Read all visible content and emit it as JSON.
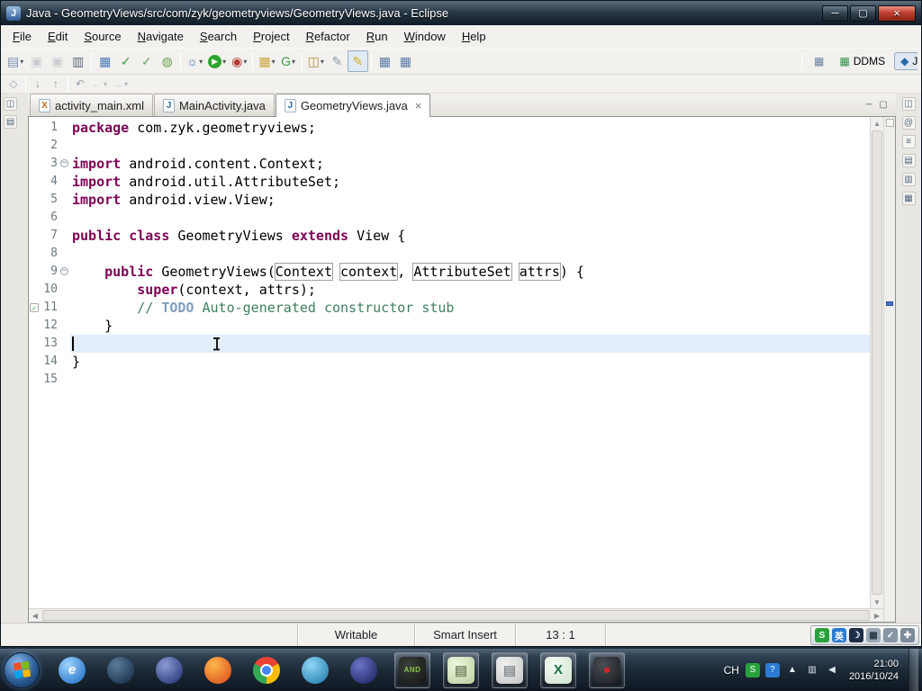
{
  "window": {
    "title": "Java - GeometryViews/src/com/zyk/geometryviews/GeometryViews.java - Eclipse",
    "app_icon_glyph": "J",
    "controls": {
      "minimize": "─",
      "maximize": "▢",
      "close": "×"
    }
  },
  "icons": {
    "dropdown": "▾",
    "tab_close": "×",
    "fold_collapsed": "−",
    "task_check": "✓",
    "scroll_up": "▲",
    "scroll_down": "▼",
    "scroll_left": "◀",
    "scroll_right": "▶",
    "minimize_view": "─",
    "maximize_view": "▢"
  },
  "menubar": {
    "items": [
      "File",
      "Edit",
      "Source",
      "Navigate",
      "Search",
      "Project",
      "Refactor",
      "Run",
      "Window",
      "Help"
    ]
  },
  "toolbar": {
    "buttons": [
      {
        "name": "new-wizard-button",
        "glyph": "▤",
        "color": "#7a8fb3",
        "dropdown": true
      },
      {
        "name": "save-button",
        "glyph": "▣",
        "color": "#8b98a8",
        "disabled": true
      },
      {
        "name": "save-all-button",
        "glyph": "▣",
        "color": "#8b98a8",
        "disabled": true
      },
      {
        "name": "print-button",
        "glyph": "▥",
        "color": "#5d6d80"
      },
      {
        "sep": true
      },
      {
        "name": "sdk-manager-button",
        "glyph": "▦",
        "color": "#4a79b8"
      },
      {
        "name": "task-list-button",
        "glyph": "✓",
        "color": "#3f9b47"
      },
      {
        "name": "verify-button",
        "glyph": "✓",
        "color": "#6aa86e"
      },
      {
        "name": "avd-manager-button",
        "glyph": "◍",
        "color": "#67a24c"
      },
      {
        "sep": true
      },
      {
        "name": "debug-button",
        "glyph": "☼",
        "color": "#3f6fb5",
        "dropdown": true
      },
      {
        "name": "run-button",
        "glyph": "▶",
        "color": "#ffffff",
        "bg": "#2ea52e",
        "dropdown": true
      },
      {
        "name": "external-tools-button",
        "glyph": "◉",
        "color": "#b23b2e",
        "dropdown": true
      },
      {
        "sep": true
      },
      {
        "name": "open-ddms-grid-button",
        "glyph": "▦",
        "color": "#caa53d",
        "dropdown": true
      },
      {
        "name": "sync-button",
        "glyph": "G",
        "color": "#3f9b47",
        "dropdown": true
      },
      {
        "sep": true
      },
      {
        "name": "new-java-element-button",
        "glyph": "◫",
        "color": "#b98a3f",
        "dropdown": true
      },
      {
        "name": "search-button",
        "glyph": "✎",
        "color": "#8d99a6"
      },
      {
        "name": "mark-occurrences-button",
        "glyph": "✎",
        "color": "#d6b01f",
        "pressed": true
      },
      {
        "sep": true
      },
      {
        "name": "annotations-button",
        "glyph": "▦",
        "color": "#5a7ca8"
      },
      {
        "name": "table-view-button",
        "glyph": "▦",
        "color": "#5a7ca8"
      }
    ],
    "perspectives": {
      "open_glyph": "▦",
      "ddms_glyph": "▦",
      "java_glyph": "◆",
      "ddms": "DDMS",
      "java": "Ja"
    }
  },
  "toolbar2": {
    "buttons": [
      {
        "name": "pin-editor-button",
        "glyph": "◇",
        "color": "#97a2ad"
      },
      {
        "sep": true
      },
      {
        "name": "next-annotation-button",
        "glyph": "↓",
        "color": "#8f9aa5"
      },
      {
        "name": "prev-annotation-button",
        "glyph": "↑",
        "color": "#8f9aa5"
      },
      {
        "sep": true
      },
      {
        "name": "last-edit-location-button",
        "glyph": "↶",
        "color": "#97a2ad"
      },
      {
        "name": "back-button",
        "glyph": "←",
        "color": "#9aa5b0",
        "dropdown": true,
        "disabled": true
      },
      {
        "name": "forward-button",
        "glyph": "→",
        "color": "#9aa5b0",
        "dropdown": true,
        "disabled": true
      }
    ]
  },
  "left_strip": {
    "icons": [
      {
        "name": "restore-package-explorer-icon",
        "glyph": "◫"
      },
      {
        "name": "restore-hierarchy-icon",
        "glyph": "▤"
      }
    ]
  },
  "right_strip": {
    "icons": [
      {
        "name": "restore-view-icon",
        "glyph": "◫"
      },
      {
        "name": "javadoc-view-icon",
        "glyph": "@"
      },
      {
        "name": "declaration-view-icon",
        "glyph": "≡"
      },
      {
        "name": "outline-view-icon",
        "glyph": "▤"
      },
      {
        "name": "problems-view-icon",
        "glyph": "▥"
      },
      {
        "name": "console-view-icon",
        "glyph": "▦"
      }
    ]
  },
  "tabs": [
    {
      "label": "activity_main.xml",
      "icon": "X",
      "icon_color": "#c06820",
      "active": false
    },
    {
      "label": "MainActivity.java",
      "icon": "J",
      "icon_color": "#2a66a8",
      "active": false
    },
    {
      "label": "GeometryViews.java",
      "icon": "J",
      "icon_color": "#2a66a8",
      "active": true
    }
  ],
  "editor": {
    "lines": [
      {
        "num": "1",
        "tokens": [
          [
            "kw",
            "package"
          ],
          [
            "pl",
            " com.zyk.geometryviews;"
          ]
        ]
      },
      {
        "num": "2",
        "tokens": []
      },
      {
        "num": "3",
        "fold": true,
        "tokens": [
          [
            "kw",
            "import"
          ],
          [
            "pl",
            " android.content.Context;"
          ]
        ]
      },
      {
        "num": "4",
        "tokens": [
          [
            "kw",
            "import"
          ],
          [
            "pl",
            " android.util.AttributeSet;"
          ]
        ]
      },
      {
        "num": "5",
        "tokens": [
          [
            "kw",
            "import"
          ],
          [
            "pl",
            " android.view.View;"
          ]
        ]
      },
      {
        "num": "6",
        "tokens": []
      },
      {
        "num": "7",
        "tokens": [
          [
            "kw",
            "public"
          ],
          [
            "pl",
            " "
          ],
          [
            "kw",
            "class"
          ],
          [
            "pl",
            " GeometryViews "
          ],
          [
            "kw",
            "extends"
          ],
          [
            "pl",
            " View {"
          ]
        ]
      },
      {
        "num": "8",
        "tokens": []
      },
      {
        "num": "9",
        "fold": true,
        "tokens": [
          [
            "pl",
            "    "
          ],
          [
            "kw",
            "public"
          ],
          [
            "pl",
            " GeometryViews("
          ],
          [
            "box",
            "Context"
          ],
          [
            "pl",
            " "
          ],
          [
            "box",
            "context"
          ],
          [
            "pl",
            ", "
          ],
          [
            "box",
            "AttributeSet"
          ],
          [
            "pl",
            " "
          ],
          [
            "box",
            "attrs"
          ],
          [
            "pl",
            ") {"
          ]
        ]
      },
      {
        "num": "10",
        "tokens": [
          [
            "pl",
            "        "
          ],
          [
            "kw",
            "super"
          ],
          [
            "pl",
            "(context, attrs);"
          ]
        ]
      },
      {
        "num": "11",
        "task": true,
        "tokens": [
          [
            "pl",
            "        "
          ],
          [
            "cm",
            "// "
          ],
          [
            "todo",
            "TODO"
          ],
          [
            "cm",
            " Auto-generated constructor stub"
          ]
        ]
      },
      {
        "num": "12",
        "tokens": [
          [
            "pl",
            "    }"
          ]
        ]
      },
      {
        "num": "13",
        "current": true,
        "caret": true,
        "tokens": []
      },
      {
        "num": "14",
        "tokens": [
          [
            "pl",
            "}"
          ]
        ]
      },
      {
        "num": "15",
        "tokens": []
      }
    ]
  },
  "statusbar": {
    "writable": "Writable",
    "insert_mode": "Smart Insert",
    "caret_position": "13 : 1"
  },
  "ime_bar": {
    "icons": [
      {
        "name": "ime-logo-icon",
        "glyph": "S",
        "bg": "#27a23c",
        "fg": "#ffffff"
      },
      {
        "name": "ime-lang-icon",
        "glyph": "英",
        "bg": "#2b7bd4",
        "fg": "#ffffff"
      },
      {
        "name": "ime-halfwidth-icon",
        "glyph": "☽",
        "bg": "#1d2c47",
        "fg": "#e8f0fa"
      },
      {
        "name": "ime-keyboard-icon",
        "glyph": "▦",
        "bg": "#9aa7b5",
        "fg": "#2c3947"
      },
      {
        "name": "ime-symbols-icon",
        "glyph": "✓",
        "bg": "#8795a5",
        "fg": "#ffffff"
      },
      {
        "name": "ime-settings-icon",
        "glyph": "✚",
        "bg": "#7c8a99",
        "fg": "#ffffff"
      }
    ]
  },
  "taskbar": {
    "apps": [
      {
        "name": "internet-explorer-icon",
        "shape": "circle",
        "c1": "#9fd4ff",
        "c2": "#1565c0",
        "label": "e",
        "label_color": "#ffffff",
        "italic": true
      },
      {
        "name": "browser-icon",
        "shape": "circle",
        "c1": "#5a7d9e",
        "c2": "#10253c",
        "label": ""
      },
      {
        "name": "media-player-icon",
        "shape": "circle",
        "c1": "#8a9bd4",
        "c2": "#1b2a6b",
        "label": ""
      },
      {
        "name": "firefox-icon",
        "shape": "circle",
        "c1": "#ffb74d",
        "c2": "#d84315",
        "label": ""
      },
      {
        "name": "chrome-icon",
        "shape": "chrome",
        "label": ""
      },
      {
        "name": "360-browser-icon",
        "shape": "circle",
        "c1": "#8fd6f5",
        "c2": "#1976a8",
        "label": ""
      },
      {
        "name": "eclipse-icon",
        "shape": "circle",
        "c1": "#6a74c8",
        "c2": "#171d57",
        "label": ""
      },
      {
        "name": "android-tool-icon",
        "shape": "square",
        "c1": "#3a3f3a",
        "c2": "#151815",
        "label": "AND",
        "label_color": "#8bc34a",
        "running": true
      },
      {
        "name": "notepad-icon",
        "shape": "square",
        "c1": "#eef7e0",
        "c2": "#b9cf9e",
        "label": "▤",
        "label_color": "#7a8d66",
        "running": true
      },
      {
        "name": "notes-icon",
        "shape": "square",
        "c1": "#f2f2f0",
        "c2": "#c2c4c6",
        "label": "▤",
        "label_color": "#8b8f94",
        "running": true
      },
      {
        "name": "excel-icon",
        "shape": "square",
        "c1": "#f4faf4",
        "c2": "#cfe3cf",
        "label": "X",
        "label_color": "#1e7145",
        "running": true
      },
      {
        "name": "recorder-icon",
        "shape": "square",
        "c1": "#4a4f55",
        "c2": "#17191c",
        "label": "●",
        "label_color": "#c62828",
        "running": true
      }
    ],
    "tray": {
      "lang": "CH",
      "icons": [
        {
          "name": "ime-tray-icon",
          "glyph": "S",
          "bg": "#27a23c",
          "fg": "#ffffff"
        },
        {
          "name": "security-tray-icon",
          "glyph": "?",
          "bg": "#2b7bd4",
          "fg": "#ffffff"
        },
        {
          "name": "hidden-icons-button",
          "glyph": "▲",
          "bg": "",
          "fg": "#e8eef4"
        },
        {
          "name": "network-tray-icon",
          "glyph": "▥",
          "bg": "",
          "fg": "#dfe7ee"
        },
        {
          "name": "volume-tray-icon",
          "glyph": "◀",
          "bg": "",
          "fg": "#dfe7ee"
        }
      ],
      "time": "21:00",
      "date": "2016/10/24"
    }
  }
}
